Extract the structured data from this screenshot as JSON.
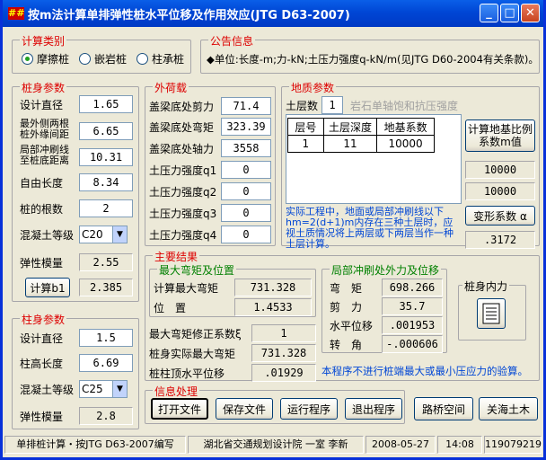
{
  "window": {
    "title": "按m法计算单排弹性桩水平位移及作用效应(JTG D63-2007)",
    "icon_text": "##"
  },
  "calc_type": {
    "legend": "计算类别",
    "options": [
      "摩擦桩",
      "嵌岩桩",
      "柱承桩"
    ],
    "selected": 0
  },
  "notice": {
    "legend": "公告信息",
    "text": "◆单位:长度-m;力-kN;土压力强度q-kN/m(见JTG D60-2004有关条款)。"
  },
  "pile_params": {
    "legend": "桩身参数",
    "design_dia_label": "设计直径",
    "design_dia": "1.65",
    "min_spacing_label": "最外侧两根桩外缘间距",
    "min_spacing": "6.65",
    "scour_label": "局部冲刷线至桩底距离",
    "scour": "10.31",
    "free_len_label": "自由长度",
    "free_len": "8.34",
    "num_label": "桩的根数",
    "num": "2",
    "concrete_label": "混凝土等级",
    "concrete": "C20",
    "modulus_label": "弹性模量",
    "modulus": "2.55",
    "calc_b1_label": "计算b1",
    "b1": "2.385"
  },
  "column_params": {
    "legend": "柱身参数",
    "dia_label": "设计直径",
    "dia": "1.5",
    "height_label": "柱高长度",
    "height": "6.69",
    "concrete_label": "混凝土等级",
    "concrete": "C25",
    "modulus_label": "弹性模量",
    "modulus": "2.8"
  },
  "loads": {
    "legend": "外荷载",
    "shear_label": "盖梁底处剪力",
    "shear": "71.4",
    "moment_label": "盖梁底处弯矩",
    "moment": "323.39",
    "axial_label": "盖梁底处轴力",
    "axial": "3558",
    "q1_label": "土压力强度q1",
    "q1": "0",
    "q2_label": "土压力强度q2",
    "q2": "0",
    "q3_label": "土压力强度q3",
    "q3": "0",
    "q4_label": "土压力强度q4",
    "q4": "0"
  },
  "geology": {
    "legend": "地质参数",
    "layers_label": "土层数",
    "layers": "1",
    "rock_label": "岩石单轴饱和抗压强度",
    "table_headers": [
      "层号",
      "土层深度",
      "地基系数"
    ],
    "table_rows": [
      [
        "1",
        "11",
        "10000"
      ]
    ],
    "calc_m_button": "计算地基比例系数m值",
    "m1": "10000",
    "m2": "10000",
    "alpha_button": "变形系数 α",
    "alpha": ".3172",
    "note": "实际工程中，地面或局部冲刷线以下hm=2(d+1)m内存在三种土层时，应视土质情况将上两层或下两层当作一种土层计算。"
  },
  "results": {
    "legend": "主要结果",
    "max_moment_legend": "最大弯矩及位置",
    "calc_max_moment_label": "计算最大弯矩",
    "calc_max_moment": "731.328",
    "position_label": "位　置",
    "position": "1.4533",
    "correction_label": "最大弯矩修正系数ξ",
    "correction": "1",
    "actual_max_moment_label": "桩身实际最大弯矩",
    "actual_max_moment": "731.328",
    "top_disp_label": "桩柱顶水平位移",
    "top_disp": ".01929",
    "scour_legend": "局部冲刷处外力及位移",
    "moment_label": "弯　矩",
    "moment": "698.266",
    "shear_label": "剪　力",
    "shear": "35.7",
    "hdisp_label": "水平位移",
    "hdisp": ".001953",
    "rot_label": "转　角",
    "rot": "-.000606",
    "internal_force_label": "桩身内力",
    "note": "本程序不进行桩端最大或最小压应力的验算。"
  },
  "info": {
    "legend": "信息处理",
    "buttons": [
      "打开文件",
      "保存文件",
      "运行程序",
      "退出程序"
    ],
    "extra_buttons": [
      "路桥空间",
      "关海土木"
    ]
  },
  "status": {
    "cells": [
      "单排桩计算・按JTG D63-2007编写",
      "湖北省交通规划设计院 一室 李新",
      "2008-05-27",
      "14:08",
      "119079219"
    ]
  }
}
